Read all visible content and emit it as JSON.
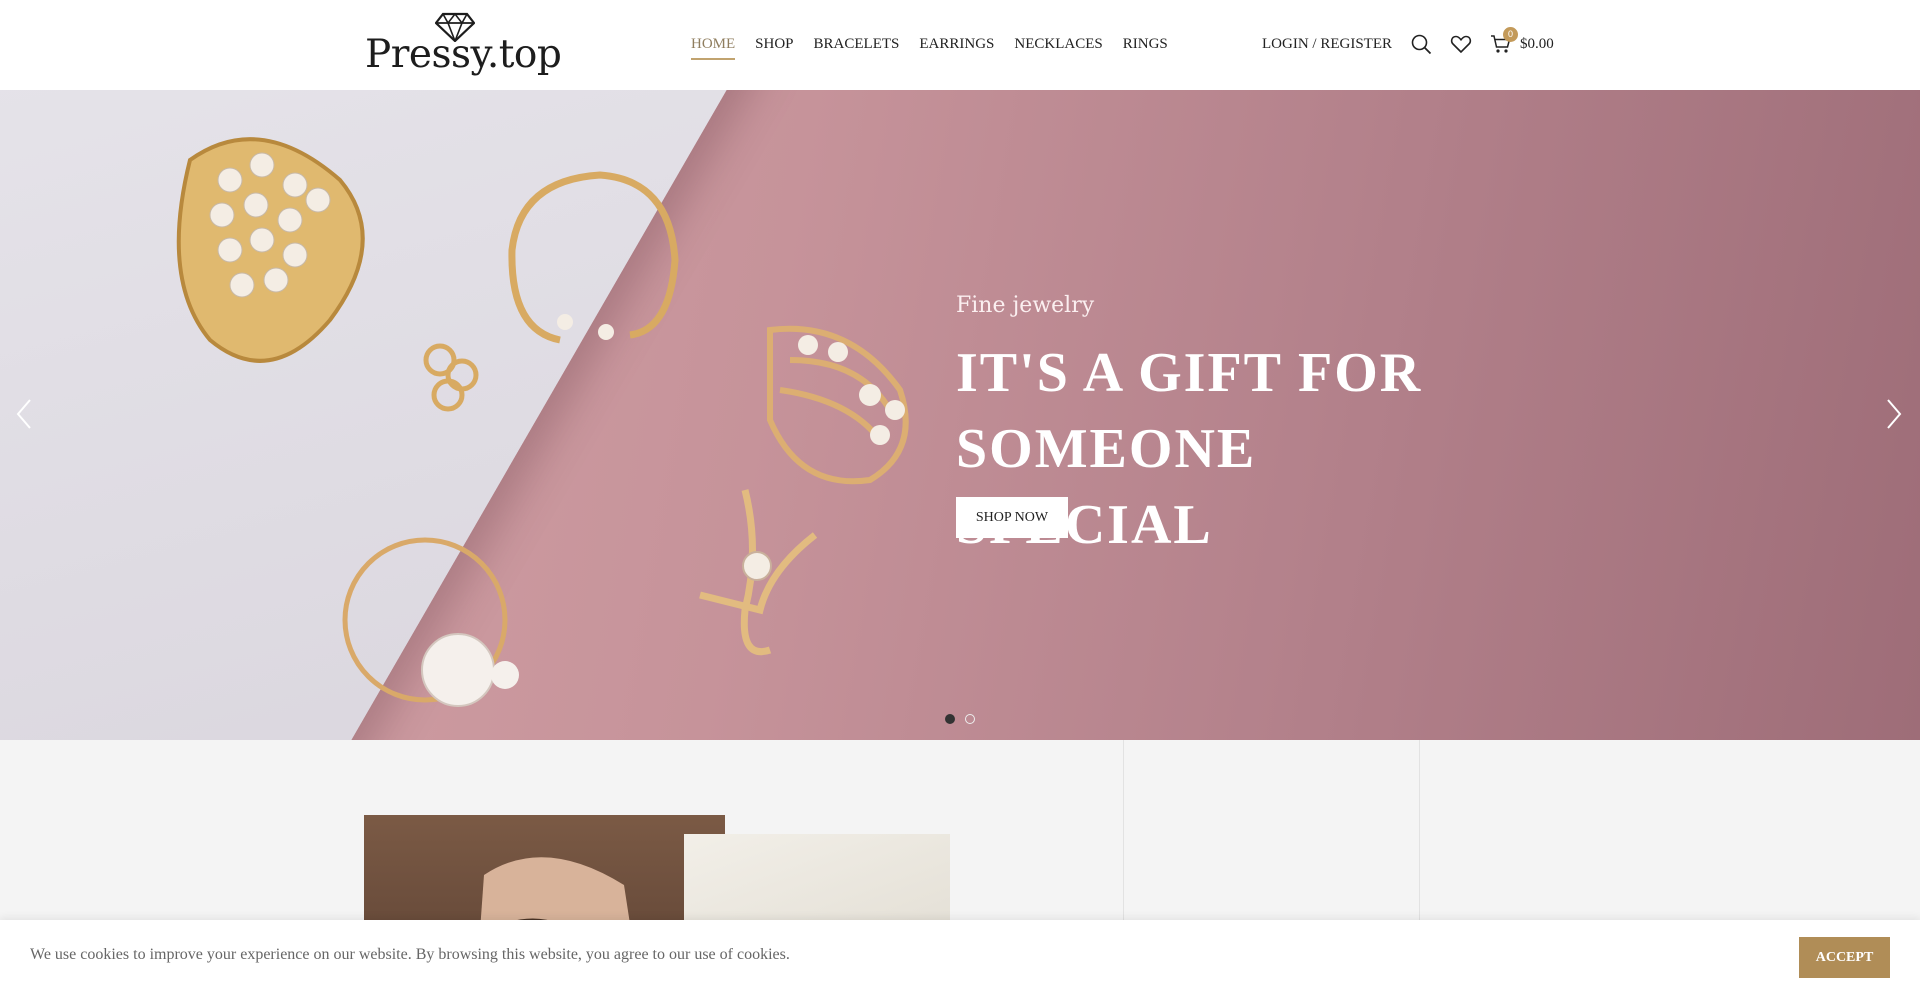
{
  "header": {
    "logo_text": "Pressy.top",
    "nav": [
      {
        "label": "HOME",
        "active": true
      },
      {
        "label": "SHOP"
      },
      {
        "label": "BRACELETS"
      },
      {
        "label": "EARRINGS"
      },
      {
        "label": "NECKLACES"
      },
      {
        "label": "RINGS"
      }
    ],
    "login_label": "LOGIN / REGISTER",
    "cart_count": "0",
    "cart_total": "$0.00",
    "icons": [
      "search-icon",
      "heart-icon",
      "cart-icon"
    ]
  },
  "hero": {
    "subtitle": "Fine jewelry",
    "title": "IT'S A GIFT FOR SOMEONE SPECIAL",
    "button_label": "SHOP NOW",
    "slides": 2,
    "active_slide": 1
  },
  "cookie": {
    "text": "We use cookies to improve your experience on our website. By browsing this website, you agree to our use of cookies.",
    "accept_label": "ACCEPT"
  },
  "colors": {
    "accent": "#c1a36f",
    "accept_button": "#b08d57",
    "hero_background": "#c6939a"
  }
}
